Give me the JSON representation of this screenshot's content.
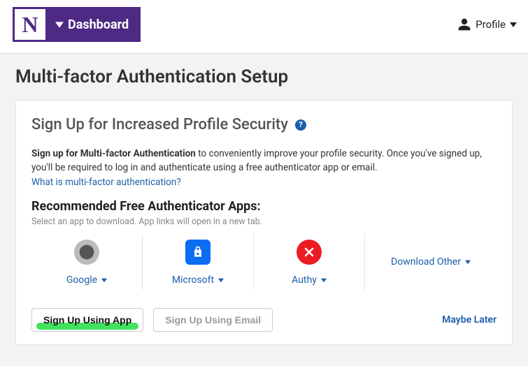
{
  "header": {
    "logo_letter": "N",
    "dashboard_label": "Dashboard",
    "profile_label": "Profile"
  },
  "page": {
    "title": "Multi-factor Authentication Setup"
  },
  "card": {
    "title": "Sign Up for Increased Profile Security",
    "help_glyph": "?",
    "desc_bold": "Sign up for Multi-factor Authentication",
    "desc_rest": " to conveniently improve your profile security. Once you've signed up, you'll be required to log in and authenticate using a free authenticator app or email.",
    "what_link": "What is multi-factor authentication?",
    "rec_title": "Recommended Free Authenticator Apps:",
    "rec_sub": "Select an app to download. App links will open in a new tab.",
    "apps": {
      "google": "Google",
      "microsoft": "Microsoft",
      "authy": "Authy",
      "other": "Download Other"
    },
    "actions": {
      "signup_app": "Sign Up Using App",
      "signup_email": "Sign Up Using Email",
      "maybe_later": "Maybe Later"
    }
  },
  "colors": {
    "brand": "#4e2a84",
    "link": "#1b5faa",
    "highlight": "#2ee04a"
  }
}
